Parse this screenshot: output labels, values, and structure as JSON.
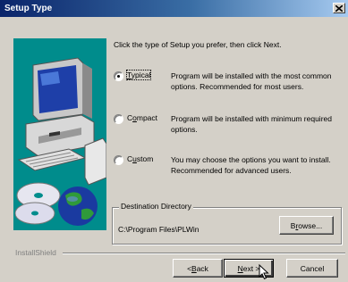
{
  "window": {
    "title": "Setup Type",
    "close_glyph": "✕"
  },
  "intro": "Click the type of Setup you prefer, then click Next.",
  "options": [
    {
      "label_pre": "",
      "label_key": "T",
      "label_post": "ypical",
      "selected": true,
      "desc1": "Program will be installed with the most common",
      "desc2": "options. Recommended for most users."
    },
    {
      "label_pre": "C",
      "label_key": "o",
      "label_post": "mpact",
      "selected": false,
      "desc1": "Program will be installed with minimum required",
      "desc2": "options."
    },
    {
      "label_pre": "C",
      "label_key": "u",
      "label_post": "stom",
      "selected": false,
      "desc1": "You may choose the options you want to install.",
      "desc2": "Recommended for advanced users."
    }
  ],
  "destination": {
    "legend": "Destination Directory",
    "path": "C:\\Program Files\\PLWin",
    "browse_pre": "B",
    "browse_key": "r",
    "browse_post": "owse..."
  },
  "footer": {
    "brand": "InstallShield",
    "back_pre": "< ",
    "back_key": "B",
    "back_post": "ack",
    "next_key": "N",
    "next_post": "ext >",
    "cancel": "Cancel"
  },
  "colors": {
    "title_start": "#0a246a",
    "title_end": "#a6caf0",
    "art_bg": "#008c8c",
    "face": "#d4d0c8"
  }
}
